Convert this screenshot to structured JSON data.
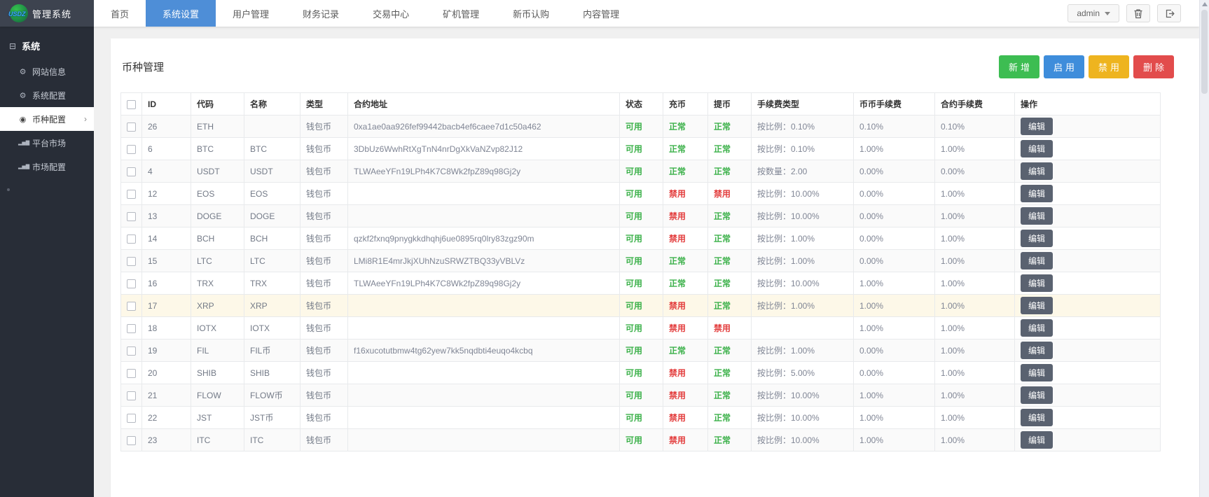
{
  "topbar": {
    "logo_text": "USDZ",
    "app_title": "管理系统",
    "nav_items": [
      {
        "label": "首页",
        "active": false
      },
      {
        "label": "系统设置",
        "active": true
      },
      {
        "label": "用户管理",
        "active": false
      },
      {
        "label": "财务记录",
        "active": false
      },
      {
        "label": "交易中心",
        "active": false
      },
      {
        "label": "矿机管理",
        "active": false
      },
      {
        "label": "新币认购",
        "active": false
      },
      {
        "label": "内容管理",
        "active": false
      }
    ],
    "user_menu_label": "admin"
  },
  "sidebar": {
    "section_label": "系统",
    "items": [
      {
        "label": "网站信息",
        "icon": "gear-icon",
        "active": false
      },
      {
        "label": "系统配置",
        "icon": "gear-icon",
        "active": false
      },
      {
        "label": "币种配置",
        "icon": "target-icon",
        "active": true
      },
      {
        "label": "平台市场",
        "icon": "chart-icon",
        "active": false
      },
      {
        "label": "市场配置",
        "icon": "chart-icon",
        "active": false
      }
    ]
  },
  "page": {
    "title": "币种管理",
    "actions": [
      {
        "label": "新增",
        "color": "#3dbd52",
        "name": "add-button"
      },
      {
        "label": "启用",
        "color": "#3e8ddb",
        "name": "enable-button"
      },
      {
        "label": "禁用",
        "color": "#eeb41f",
        "name": "disable-button"
      },
      {
        "label": "删除",
        "color": "#e24c4c",
        "name": "delete-button"
      }
    ]
  },
  "table": {
    "columns": [
      "ID",
      "代码",
      "名称",
      "类型",
      "合约地址",
      "状态",
      "充币",
      "提币",
      "手续费类型",
      "币币手续费",
      "合约手续费",
      "操作"
    ],
    "edit_label": "编辑",
    "rows": [
      {
        "id": "26",
        "code": "ETH",
        "name": "",
        "type": "钱包币",
        "address": "0xa1ae0aa926fef99442bacb4ef6caee7d1c50a462",
        "status": "可用",
        "deposit": "正常",
        "withdraw": "正常",
        "fee_type": "按比例：0.10%",
        "coin_fee": "0.10%",
        "contract_fee": "0.10%",
        "highlight": false
      },
      {
        "id": "6",
        "code": "BTC",
        "name": "BTC",
        "type": "钱包币",
        "address": "3DbUz6WwhRtXgTnN4nrDgXkVaNZvp82J12",
        "status": "可用",
        "deposit": "正常",
        "withdraw": "正常",
        "fee_type": "按比例：0.10%",
        "coin_fee": "1.00%",
        "contract_fee": "1.00%",
        "highlight": false
      },
      {
        "id": "4",
        "code": "USDT",
        "name": "USDT",
        "type": "钱包币",
        "address": "TLWAeeYFn19LPh4K7C8Wk2fpZ89q98Gj2y",
        "status": "可用",
        "deposit": "正常",
        "withdraw": "正常",
        "fee_type": "按数量：2.00",
        "coin_fee": "0.00%",
        "contract_fee": "0.00%",
        "highlight": false
      },
      {
        "id": "12",
        "code": "EOS",
        "name": "EOS",
        "type": "钱包币",
        "address": "",
        "status": "可用",
        "deposit": "禁用",
        "withdraw": "禁用",
        "fee_type": "按比例：10.00%",
        "coin_fee": "0.00%",
        "contract_fee": "1.00%",
        "highlight": false
      },
      {
        "id": "13",
        "code": "DOGE",
        "name": "DOGE",
        "type": "钱包币",
        "address": "",
        "status": "可用",
        "deposit": "禁用",
        "withdraw": "正常",
        "fee_type": "按比例：10.00%",
        "coin_fee": "0.00%",
        "contract_fee": "1.00%",
        "highlight": false
      },
      {
        "id": "14",
        "code": "BCH",
        "name": "BCH",
        "type": "钱包币",
        "address": "qzkf2fxnq9pnygkkdhqhj6ue0895rq0lry83zgz90m",
        "status": "可用",
        "deposit": "禁用",
        "withdraw": "正常",
        "fee_type": "按比例：1.00%",
        "coin_fee": "0.00%",
        "contract_fee": "1.00%",
        "highlight": false
      },
      {
        "id": "15",
        "code": "LTC",
        "name": "LTC",
        "type": "钱包币",
        "address": "LMi8R1E4mrJkjXUhNzuSRWZTBQ33yVBLVz",
        "status": "可用",
        "deposit": "正常",
        "withdraw": "正常",
        "fee_type": "按比例：1.00%",
        "coin_fee": "0.00%",
        "contract_fee": "1.00%",
        "highlight": false
      },
      {
        "id": "16",
        "code": "TRX",
        "name": "TRX",
        "type": "钱包币",
        "address": "TLWAeeYFn19LPh4K7C8Wk2fpZ89q98Gj2y",
        "status": "可用",
        "deposit": "正常",
        "withdraw": "正常",
        "fee_type": "按比例：10.00%",
        "coin_fee": "1.00%",
        "contract_fee": "1.00%",
        "highlight": false
      },
      {
        "id": "17",
        "code": "XRP",
        "name": "XRP",
        "type": "钱包币",
        "address": "",
        "status": "可用",
        "deposit": "禁用",
        "withdraw": "正常",
        "fee_type": "按比例：1.00%",
        "coin_fee": "1.00%",
        "contract_fee": "1.00%",
        "highlight": true
      },
      {
        "id": "18",
        "code": "IOTX",
        "name": "IOTX",
        "type": "钱包币",
        "address": "",
        "status": "可用",
        "deposit": "禁用",
        "withdraw": "禁用",
        "fee_type": "",
        "coin_fee": "1.00%",
        "contract_fee": "1.00%",
        "highlight": false
      },
      {
        "id": "19",
        "code": "FIL",
        "name": "FIL币",
        "type": "钱包币",
        "address": "f16xucotutbmw4tg62yew7kk5nqdbti4euqo4kcbq",
        "status": "可用",
        "deposit": "正常",
        "withdraw": "正常",
        "fee_type": "按比例：1.00%",
        "coin_fee": "0.00%",
        "contract_fee": "1.00%",
        "highlight": false
      },
      {
        "id": "20",
        "code": "SHIB",
        "name": "SHIB",
        "type": "钱包币",
        "address": "",
        "status": "可用",
        "deposit": "禁用",
        "withdraw": "正常",
        "fee_type": "按比例：5.00%",
        "coin_fee": "0.00%",
        "contract_fee": "1.00%",
        "highlight": false
      },
      {
        "id": "21",
        "code": "FLOW",
        "name": "FLOW币",
        "type": "钱包币",
        "address": "",
        "status": "可用",
        "deposit": "禁用",
        "withdraw": "正常",
        "fee_type": "按比例：10.00%",
        "coin_fee": "1.00%",
        "contract_fee": "1.00%",
        "highlight": false
      },
      {
        "id": "22",
        "code": "JST",
        "name": "JST币",
        "type": "钱包币",
        "address": "",
        "status": "可用",
        "deposit": "禁用",
        "withdraw": "正常",
        "fee_type": "按比例：10.00%",
        "coin_fee": "1.00%",
        "contract_fee": "1.00%",
        "highlight": false
      },
      {
        "id": "23",
        "code": "ITC",
        "name": "ITC",
        "type": "钱包币",
        "address": "",
        "status": "可用",
        "deposit": "禁用",
        "withdraw": "正常",
        "fee_type": "按比例：10.00%",
        "coin_fee": "1.00%",
        "contract_fee": "1.00%",
        "highlight": false
      }
    ]
  },
  "colors": {
    "status_ok": "#3cb14a",
    "status_bad": "#e33e3e",
    "nav_active": "#4e8ed7",
    "sidebar_bg": "#282d37",
    "edit_button": "#5a6270"
  }
}
